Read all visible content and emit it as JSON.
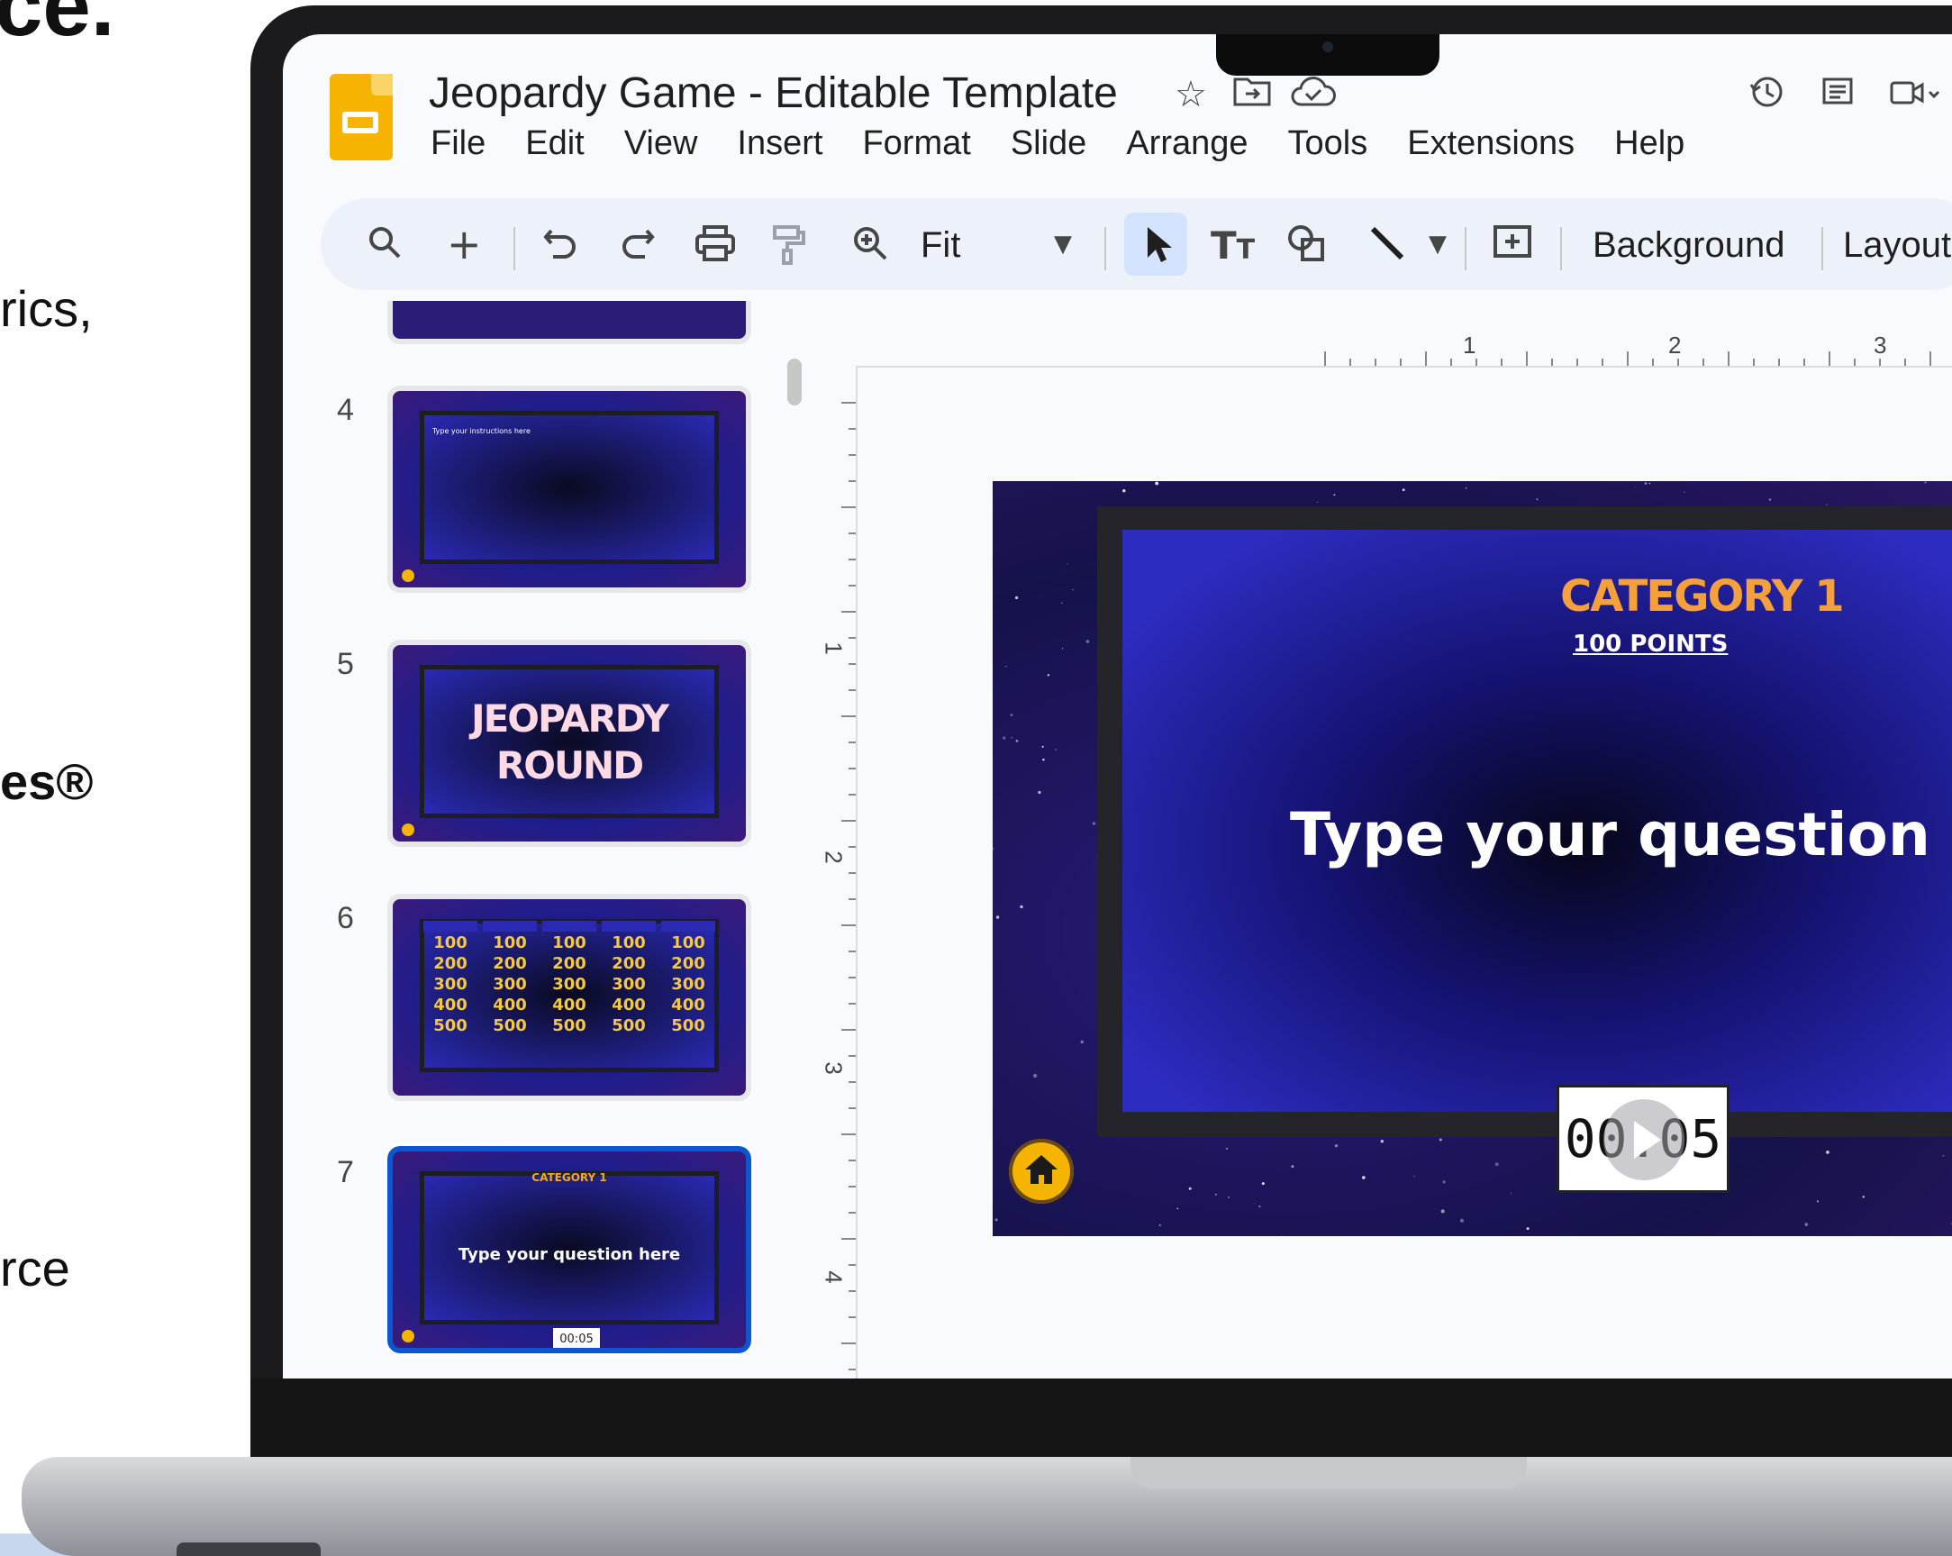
{
  "background_text": {
    "top": "ce.",
    "line1": "rics,",
    "line2": "es®",
    "line3": "rce"
  },
  "app": {
    "doc_title": "Jeopardy Game - Editable Template",
    "menu": [
      "File",
      "Edit",
      "View",
      "Insert",
      "Format",
      "Slide",
      "Arrange",
      "Tools",
      "Extensions",
      "Help"
    ],
    "icons": {
      "star": "star-icon",
      "move": "move-to-folder-icon",
      "cloud": "cloud-saved-icon",
      "history": "version-history-icon",
      "comments": "comments-icon",
      "meet": "meet-icon"
    }
  },
  "toolbar": {
    "zoom_label": "Fit",
    "background_label": "Background",
    "layout_label": "Layout"
  },
  "ruler": {
    "h_numbers": [
      "1",
      "2",
      "3"
    ],
    "v_numbers": [
      "1",
      "2",
      "3",
      "4"
    ]
  },
  "filmstrip": {
    "slides": [
      {
        "number": "4",
        "text": "Type your instructions here"
      },
      {
        "number": "5",
        "title_line1": "JEOPARDY",
        "title_line2": "ROUND"
      },
      {
        "number": "6",
        "grid": [
          "100",
          "200",
          "300",
          "400",
          "500"
        ]
      },
      {
        "number": "7",
        "category": "CATEGORY 1",
        "question": "Type your question here",
        "timer": "00:05",
        "active": true
      }
    ]
  },
  "slide": {
    "category": "CATEGORY 1",
    "points": "100 POINTS",
    "question": "Type your question here",
    "timer": "00:05"
  },
  "colors": {
    "accent": "#0b57d0",
    "logo": "#f6b400",
    "category": "#f5a03a",
    "points_value": "#f5c842"
  }
}
